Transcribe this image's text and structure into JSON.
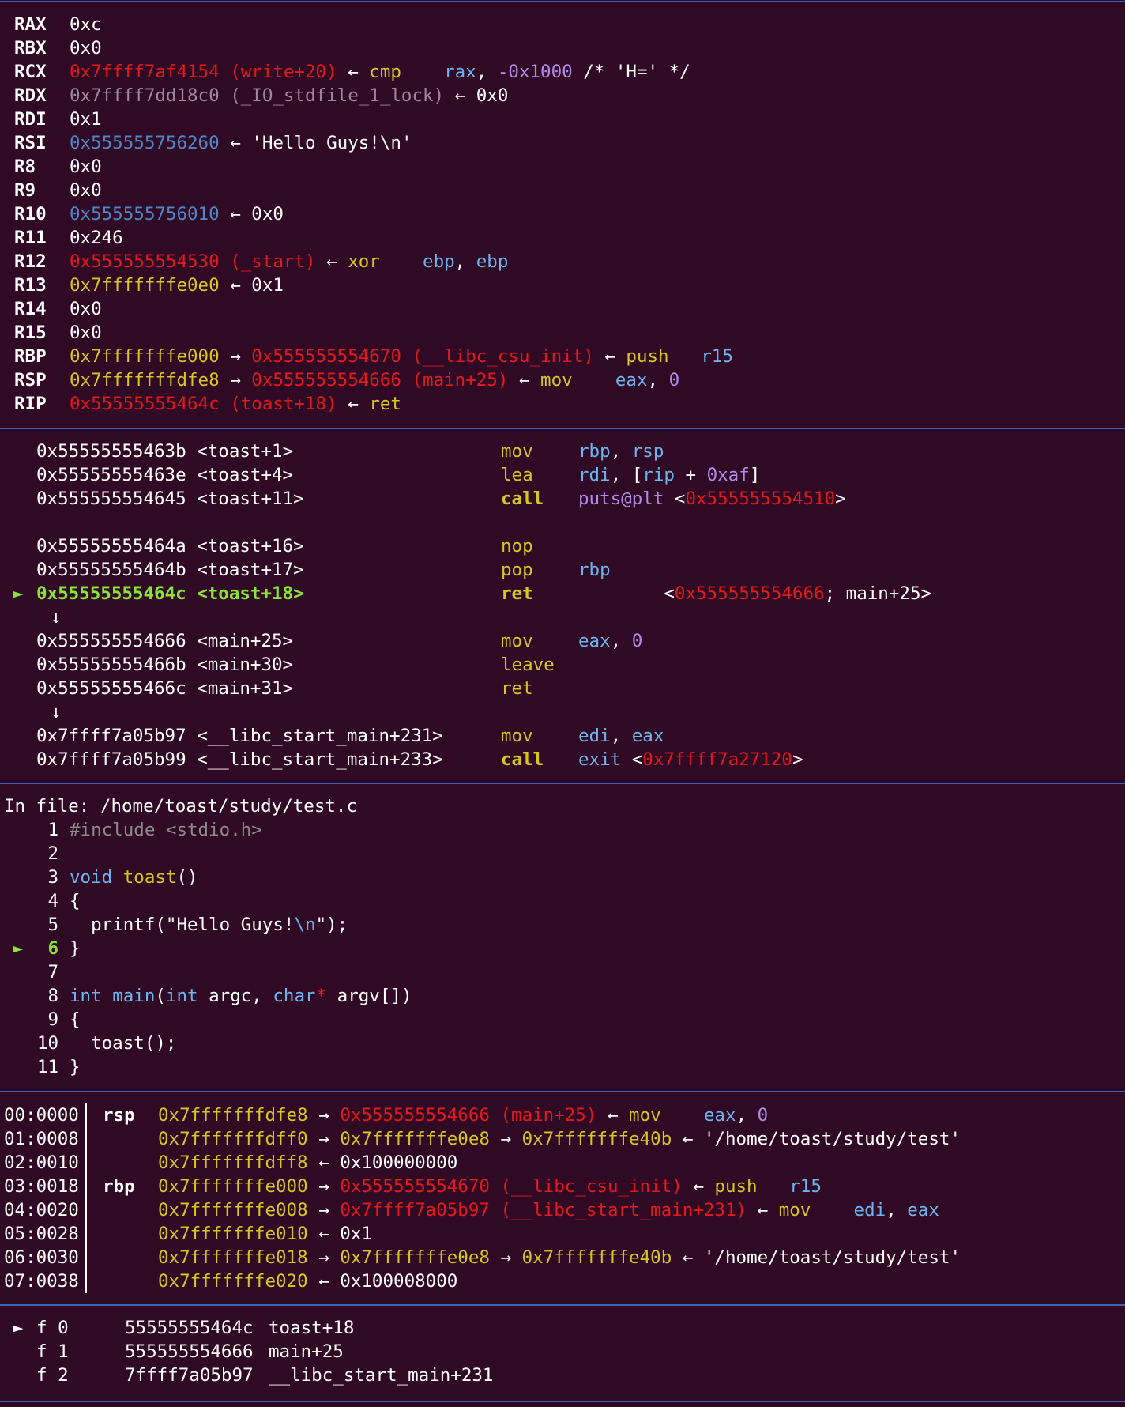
{
  "colors": {
    "background": "#300a24",
    "separator": "#3a62b8",
    "red": "#e31a1c",
    "gray": "#9b8a9b",
    "blue": "#4e87c8",
    "yellow": "#d6c620",
    "cyan": "#6cb4f0",
    "purple": "#b08ae8",
    "green": "#8ae234"
  },
  "registers": [
    {
      "name": "RAX",
      "parts": [
        {
          "t": "0xc",
          "c": "w"
        }
      ]
    },
    {
      "name": "RBX",
      "parts": [
        {
          "t": "0x0",
          "c": "w"
        }
      ]
    },
    {
      "name": "RCX",
      "parts": [
        {
          "t": "0x7ffff7af4154 (write+20)",
          "c": "red"
        },
        {
          "t": " ← ",
          "c": "w"
        },
        {
          "t": "cmp    ",
          "c": "yel"
        },
        {
          "t": "rax",
          "c": "cyan"
        },
        {
          "t": ", ",
          "c": "w"
        },
        {
          "t": "-0x1000",
          "c": "purp"
        },
        {
          "t": " /* 'H=' */",
          "c": "w"
        }
      ]
    },
    {
      "name": "RDX",
      "parts": [
        {
          "t": "0x7ffff7dd18c0 (_IO_stdfile_1_lock)",
          "c": "gray"
        },
        {
          "t": " ← 0x0",
          "c": "w"
        }
      ]
    },
    {
      "name": "RDI",
      "parts": [
        {
          "t": "0x1",
          "c": "w"
        }
      ]
    },
    {
      "name": "RSI",
      "parts": [
        {
          "t": "0x555555756260",
          "c": "blue"
        },
        {
          "t": " ← 'Hello Guys!\\n'",
          "c": "w"
        }
      ]
    },
    {
      "name": "R8",
      "parts": [
        {
          "t": "0x0",
          "c": "w"
        }
      ]
    },
    {
      "name": "R9",
      "parts": [
        {
          "t": "0x0",
          "c": "w"
        }
      ]
    },
    {
      "name": "R10",
      "parts": [
        {
          "t": "0x555555756010",
          "c": "blue"
        },
        {
          "t": " ← 0x0",
          "c": "w"
        }
      ]
    },
    {
      "name": "R11",
      "parts": [
        {
          "t": "0x246",
          "c": "w"
        }
      ]
    },
    {
      "name": "R12",
      "parts": [
        {
          "t": "0x555555554530 (_start)",
          "c": "red"
        },
        {
          "t": " ← ",
          "c": "w"
        },
        {
          "t": "xor    ",
          "c": "yel"
        },
        {
          "t": "ebp",
          "c": "cyan"
        },
        {
          "t": ", ",
          "c": "w"
        },
        {
          "t": "ebp",
          "c": "cyan"
        }
      ]
    },
    {
      "name": "R13",
      "parts": [
        {
          "t": "0x7fffffffe0e0",
          "c": "yel"
        },
        {
          "t": " ← 0x1",
          "c": "w"
        }
      ]
    },
    {
      "name": "R14",
      "parts": [
        {
          "t": "0x0",
          "c": "w"
        }
      ]
    },
    {
      "name": "R15",
      "parts": [
        {
          "t": "0x0",
          "c": "w"
        }
      ]
    },
    {
      "name": "RBP",
      "parts": [
        {
          "t": "0x7fffffffe000",
          "c": "yel"
        },
        {
          "t": " → ",
          "c": "w"
        },
        {
          "t": "0x555555554670 (__libc_csu_init)",
          "c": "red"
        },
        {
          "t": " ← ",
          "c": "w"
        },
        {
          "t": "push   ",
          "c": "yel"
        },
        {
          "t": "r15",
          "c": "cyan"
        }
      ]
    },
    {
      "name": "RSP",
      "parts": [
        {
          "t": "0x7fffffffdfe8",
          "c": "yel"
        },
        {
          "t": " → ",
          "c": "w"
        },
        {
          "t": "0x555555554666 (main+25)",
          "c": "red"
        },
        {
          "t": " ← ",
          "c": "w"
        },
        {
          "t": "mov    ",
          "c": "yel"
        },
        {
          "t": "eax",
          "c": "cyan"
        },
        {
          "t": ", ",
          "c": "w"
        },
        {
          "t": "0",
          "c": "purp"
        }
      ]
    },
    {
      "name": "RIP",
      "parts": [
        {
          "t": "0x55555555464c (toast+18)",
          "c": "red"
        },
        {
          "t": " ← ",
          "c": "w"
        },
        {
          "t": "ret",
          "c": "yel"
        }
      ]
    }
  ],
  "disasm": [
    {
      "marker": "",
      "addr": "0x55555555463b <toast+1>",
      "mnem": "mov",
      "ops": [
        {
          "t": "rbp",
          "c": "cyan"
        },
        {
          "t": ", ",
          "c": "w"
        },
        {
          "t": "rsp",
          "c": "cyan"
        }
      ]
    },
    {
      "marker": "",
      "addr": "0x55555555463e <toast+4>",
      "mnem": "lea",
      "ops": [
        {
          "t": "rdi",
          "c": "cyan"
        },
        {
          "t": ", [",
          "c": "w"
        },
        {
          "t": "rip",
          "c": "cyan"
        },
        {
          "t": " + ",
          "c": "w"
        },
        {
          "t": "0xaf",
          "c": "purp"
        },
        {
          "t": "]",
          "c": "w"
        }
      ]
    },
    {
      "marker": "",
      "addr": "0x555555554645 <toast+11>",
      "mnem": "call",
      "bold": true,
      "ops": [
        {
          "t": "puts@plt",
          "c": "purp"
        },
        {
          "t": " <",
          "c": "w"
        },
        {
          "t": "0x555555554510",
          "c": "red"
        },
        {
          "t": ">",
          "c": "w"
        }
      ]
    },
    {
      "blank": true
    },
    {
      "marker": "",
      "addr": "0x55555555464a <toast+16>",
      "mnem": "nop",
      "ops": []
    },
    {
      "marker": "",
      "addr": "0x55555555464b <toast+17>",
      "mnem": "pop",
      "ops": [
        {
          "t": "rbp",
          "c": "cyan"
        }
      ]
    },
    {
      "marker": "►",
      "current": true,
      "addr": "0x55555555464c <toast+18>",
      "mnem": "ret",
      "bold": true,
      "ops": [
        {
          "t": "        <",
          "c": "w"
        },
        {
          "t": "0x555555554666",
          "c": "red"
        },
        {
          "t": "; main+25>",
          "c": "w"
        }
      ]
    },
    {
      "arrow": "↓"
    },
    {
      "marker": "",
      "addr": "0x555555554666 <main+25>",
      "mnem": "mov",
      "ops": [
        {
          "t": "eax",
          "c": "cyan"
        },
        {
          "t": ", ",
          "c": "w"
        },
        {
          "t": "0",
          "c": "purp"
        }
      ]
    },
    {
      "marker": "",
      "addr": "0x55555555466b <main+30>",
      "mnem": "leave",
      "ops": []
    },
    {
      "marker": "",
      "addr": "0x55555555466c <main+31>",
      "mnem": "ret",
      "ops": []
    },
    {
      "arrow": "↓"
    },
    {
      "marker": "",
      "addr": "0x7ffff7a05b97 <__libc_start_main+231>",
      "mnem": "mov",
      "ops": [
        {
          "t": "edi",
          "c": "cyan"
        },
        {
          "t": ", ",
          "c": "w"
        },
        {
          "t": "eax",
          "c": "cyan"
        }
      ]
    },
    {
      "marker": "",
      "addr": "0x7ffff7a05b99 <__libc_start_main+233>",
      "mnem": "call",
      "bold": true,
      "ops": [
        {
          "t": "exit",
          "c": "cyan"
        },
        {
          "t": " <",
          "c": "w"
        },
        {
          "t": "0x7ffff7a27120",
          "c": "red"
        },
        {
          "t": ">",
          "c": "w"
        }
      ]
    }
  ],
  "source": {
    "header": "In file: /home/toast/study/test.c",
    "lines": [
      {
        "n": "1",
        "parts": [
          {
            "t": "#include <stdio.h>",
            "c": "cmt"
          }
        ]
      },
      {
        "n": "2",
        "parts": []
      },
      {
        "n": "3",
        "parts": [
          {
            "t": "void",
            "c": "cyan"
          },
          {
            "t": " ",
            "c": "w"
          },
          {
            "t": "toast",
            "c": "yel"
          },
          {
            "t": "()",
            "c": "w"
          }
        ]
      },
      {
        "n": "4",
        "parts": [
          {
            "t": "{",
            "c": "w"
          }
        ]
      },
      {
        "n": "5",
        "parts": [
          {
            "t": "  printf(\"Hello Guys!",
            "c": "w"
          },
          {
            "t": "\\n",
            "c": "cyan"
          },
          {
            "t": "\");",
            "c": "w"
          }
        ]
      },
      {
        "n": "6",
        "current": true,
        "parts": [
          {
            "t": "}",
            "c": "w"
          }
        ]
      },
      {
        "n": "7",
        "parts": []
      },
      {
        "n": "8",
        "parts": [
          {
            "t": "int",
            "c": "cyan"
          },
          {
            "t": " ",
            "c": "w"
          },
          {
            "t": "main",
            "c": "cyan"
          },
          {
            "t": "(",
            "c": "w"
          },
          {
            "t": "int",
            "c": "cyan"
          },
          {
            "t": " argc, ",
            "c": "w"
          },
          {
            "t": "char",
            "c": "cyan"
          },
          {
            "t": "*",
            "c": "red"
          },
          {
            "t": " argv[])",
            "c": "w"
          }
        ]
      },
      {
        "n": "9",
        "parts": [
          {
            "t": "{",
            "c": "w"
          }
        ]
      },
      {
        "n": "10",
        "parts": [
          {
            "t": "  toast();",
            "c": "w"
          }
        ]
      },
      {
        "n": "11",
        "parts": [
          {
            "t": "}",
            "c": "w"
          }
        ]
      }
    ]
  },
  "stack": [
    {
      "off": "00:0000",
      "reg": "rsp",
      "parts": [
        {
          "t": "0x7fffffffdfe8",
          "c": "yel"
        },
        {
          "t": " → ",
          "c": "w"
        },
        {
          "t": "0x555555554666 (main+25)",
          "c": "red"
        },
        {
          "t": " ← ",
          "c": "w"
        },
        {
          "t": "mov    ",
          "c": "yel"
        },
        {
          "t": "eax",
          "c": "cyan"
        },
        {
          "t": ", ",
          "c": "w"
        },
        {
          "t": "0",
          "c": "purp"
        }
      ]
    },
    {
      "off": "01:0008",
      "reg": "",
      "parts": [
        {
          "t": "0x7fffffffdff0",
          "c": "yel"
        },
        {
          "t": " → ",
          "c": "w"
        },
        {
          "t": "0x7fffffffe0e8",
          "c": "yel"
        },
        {
          "t": " → ",
          "c": "w"
        },
        {
          "t": "0x7fffffffe40b",
          "c": "yel"
        },
        {
          "t": " ← '/home/toast/study/test'",
          "c": "w"
        }
      ]
    },
    {
      "off": "02:0010",
      "reg": "",
      "parts": [
        {
          "t": "0x7fffffffdff8",
          "c": "yel"
        },
        {
          "t": " ← 0x100000000",
          "c": "w"
        }
      ]
    },
    {
      "off": "03:0018",
      "reg": "rbp",
      "parts": [
        {
          "t": "0x7fffffffe000",
          "c": "yel"
        },
        {
          "t": " → ",
          "c": "w"
        },
        {
          "t": "0x555555554670 (__libc_csu_init)",
          "c": "red"
        },
        {
          "t": " ← ",
          "c": "w"
        },
        {
          "t": "push   ",
          "c": "yel"
        },
        {
          "t": "r15",
          "c": "cyan"
        }
      ]
    },
    {
      "off": "04:0020",
      "reg": "",
      "parts": [
        {
          "t": "0x7fffffffe008",
          "c": "yel"
        },
        {
          "t": " → ",
          "c": "w"
        },
        {
          "t": "0x7ffff7a05b97 (__libc_start_main+231)",
          "c": "red"
        },
        {
          "t": " ← ",
          "c": "w"
        },
        {
          "t": "mov    ",
          "c": "yel"
        },
        {
          "t": "edi",
          "c": "cyan"
        },
        {
          "t": ", ",
          "c": "w"
        },
        {
          "t": "eax",
          "c": "cyan"
        }
      ]
    },
    {
      "off": "05:0028",
      "reg": "",
      "parts": [
        {
          "t": "0x7fffffffe010",
          "c": "yel"
        },
        {
          "t": " ← 0x1",
          "c": "w"
        }
      ]
    },
    {
      "off": "06:0030",
      "reg": "",
      "parts": [
        {
          "t": "0x7fffffffe018",
          "c": "yel"
        },
        {
          "t": " → ",
          "c": "w"
        },
        {
          "t": "0x7fffffffe0e8",
          "c": "yel"
        },
        {
          "t": " → ",
          "c": "w"
        },
        {
          "t": "0x7fffffffe40b",
          "c": "yel"
        },
        {
          "t": " ← '/home/toast/study/test'",
          "c": "w"
        }
      ]
    },
    {
      "off": "07:0038",
      "reg": "",
      "parts": [
        {
          "t": "0x7fffffffe020",
          "c": "yel"
        },
        {
          "t": " ← 0x100008000",
          "c": "w"
        }
      ]
    }
  ],
  "backtrace": [
    {
      "marker": "►",
      "frame": "f 0",
      "addr": "55555555464c",
      "sym": "toast+18"
    },
    {
      "marker": "",
      "frame": "f 1",
      "addr": "555555554666",
      "sym": "main+25"
    },
    {
      "marker": "",
      "frame": "f 2",
      "addr": "7ffff7a05b97",
      "sym": "__libc_start_main+231"
    }
  ]
}
